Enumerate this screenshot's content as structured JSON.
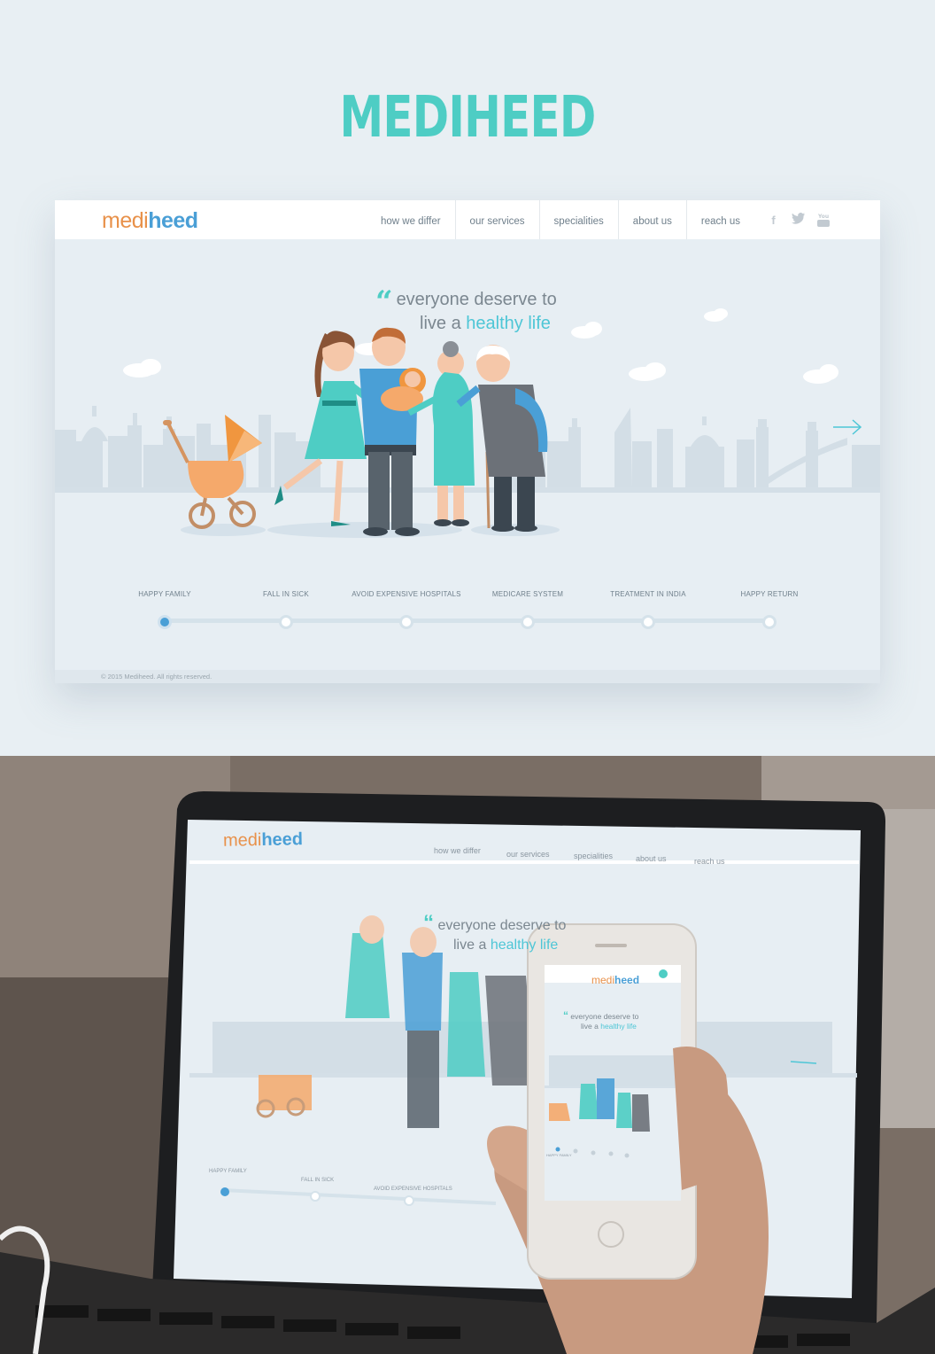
{
  "showcase": {
    "title": "MEDIHEED"
  },
  "brand": {
    "logo_part1": "medi",
    "logo_part2": "heed"
  },
  "nav": {
    "items": [
      "how we differ",
      "our services",
      "specialities",
      "about us",
      "reach us"
    ],
    "social": [
      "facebook-icon",
      "twitter-icon",
      "youtube-icon"
    ]
  },
  "hero": {
    "quote_mark": "“",
    "line1": "everyone deserve to",
    "line2_prefix": "live a",
    "line2_highlight": "healthy life"
  },
  "timeline": {
    "steps": [
      "HAPPY FAMILY",
      "FALL IN SICK",
      "AVOID EXPENSIVE HOSPITALS",
      "MEDICARE SYSTEM",
      "TREATMENT IN INDIA",
      "HAPPY RETURN"
    ],
    "active_index": 0
  },
  "footer": {
    "copyright": "© 2015 Mediheed. All rights reserved."
  },
  "colors": {
    "accent": "#4ecdc4",
    "brand_orange": "#e8914a",
    "brand_blue": "#4a9fd6",
    "background": "#e8eff3"
  }
}
